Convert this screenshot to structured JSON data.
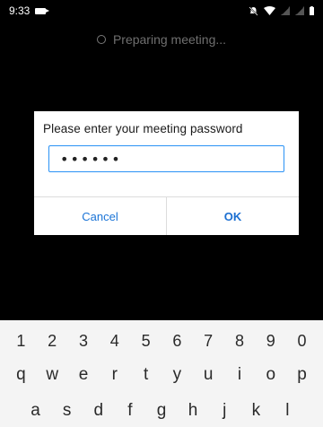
{
  "status_bar": {
    "time": "9:33",
    "left_icon": "video-camera-icon",
    "right_icons": [
      "bell-off-icon",
      "wifi-icon",
      "signal-icon",
      "signal-icon",
      "battery-icon"
    ]
  },
  "preparing": {
    "icon": "spinner-icon",
    "text": "Preparing meeting..."
  },
  "dialog": {
    "title": "Please enter your meeting password",
    "password_value": "••••••",
    "cancel_label": "Cancel",
    "ok_label": "OK",
    "accent_color": "#2a92f5"
  },
  "keyboard": {
    "digits": [
      "1",
      "2",
      "3",
      "4",
      "5",
      "6",
      "7",
      "8",
      "9",
      "0"
    ],
    "row1": [
      "q",
      "w",
      "e",
      "r",
      "t",
      "y",
      "u",
      "i",
      "o",
      "p"
    ],
    "row2": [
      "a",
      "s",
      "d",
      "f",
      "g",
      "h",
      "j",
      "k",
      "l"
    ]
  }
}
